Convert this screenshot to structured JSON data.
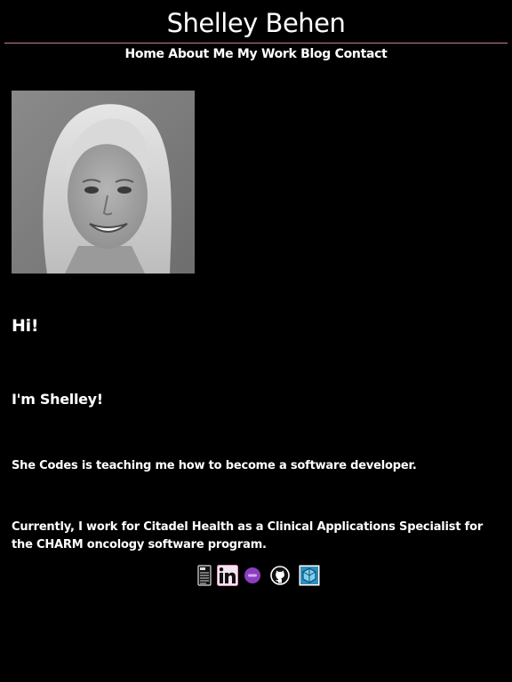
{
  "header": {
    "title": "Shelley Behen",
    "rule_color": "#c77d8f"
  },
  "nav": {
    "items": [
      {
        "label": "Home"
      },
      {
        "label": "About Me"
      },
      {
        "label": "My Work"
      },
      {
        "label": "Blog"
      },
      {
        "label": "Contact"
      }
    ]
  },
  "profile": {
    "photo_icon": "profile-photo"
  },
  "main": {
    "greeting": "Hi!",
    "intro": "I'm Shelley!",
    "paragraph1": "She Codes is teaching me how to become a software developer.",
    "paragraph2": "Currently, I work for Citadel Health as a Clinical Applications Specialist for the CHARM oncology software program."
  },
  "social": {
    "links": [
      {
        "icon": "resume-icon"
      },
      {
        "icon": "linkedin-icon"
      },
      {
        "icon": "shecodes-icon"
      },
      {
        "icon": "github-icon"
      },
      {
        "icon": "codewars-icon"
      }
    ]
  }
}
